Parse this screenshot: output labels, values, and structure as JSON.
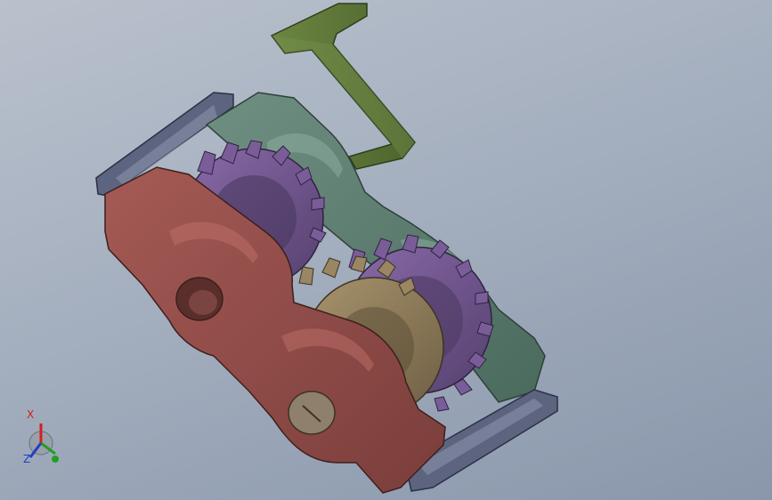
{
  "viewport": {
    "background_top": "#b9c1cc",
    "background_bottom": "#8a97ab"
  },
  "model_colors": {
    "frame_plate": "#595f7a",
    "housing_front": "#8a4a46",
    "housing_back": "#5b7a6d",
    "crank": "#5c7338",
    "gear_large": "#6a4f86",
    "gear_small": "#8a7a5a",
    "shaft": "#8e806a"
  },
  "triad": {
    "x_label": "X",
    "z_label": "Z",
    "x_color": "#d22020",
    "z_color": "#2040c0",
    "y_color": "#20a020"
  }
}
